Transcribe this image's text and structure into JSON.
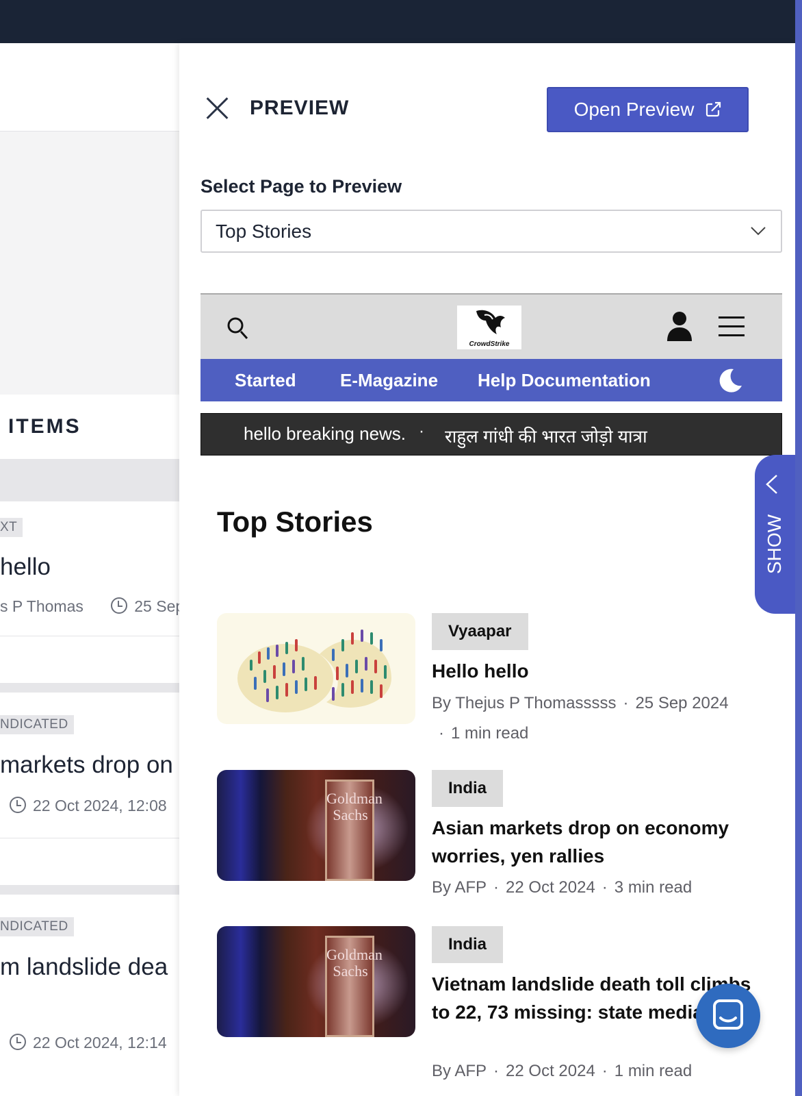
{
  "background_list": {
    "items_heading": "ITEMS",
    "cards": [
      {
        "tag": "XT",
        "title": "hello",
        "author": "s P Thomas",
        "date": "25 Sep"
      },
      {
        "tag": "NDICATED",
        "title": "markets drop on",
        "date": "22 Oct 2024, 12:08"
      },
      {
        "tag": "NDICATED",
        "title": "m landslide dea",
        "date": "22 Oct 2024, 12:14"
      }
    ]
  },
  "drawer": {
    "title": "PREVIEW",
    "open_preview_label": "Open Preview",
    "select_label": "Select Page to Preview",
    "selected_page": "Top Stories"
  },
  "preview": {
    "logo_text": "CrowdStrike",
    "nav": [
      "Started",
      "E-Magazine",
      "Help Documentation"
    ],
    "ticker": [
      "hello breaking news.",
      "राहुल गांधी की भारत जोड़ो यात्रा"
    ],
    "section_title": "Top Stories",
    "stories": [
      {
        "category": "Vyaapar",
        "title": "Hello hello",
        "byline": "By  Thejus P Thomasssss",
        "date": "25 Sep 2024",
        "read": "1 min read"
      },
      {
        "category": "India",
        "title": "Asian markets drop on economy worries, yen rallies",
        "byline": "By  AFP",
        "date": "22 Oct 2024",
        "read": "3 min read"
      },
      {
        "category": "India",
        "title": "Vietnam landslide death toll climbs to 22, 73 missing: state media",
        "byline": "By  AFP",
        "date": "22 Oct 2024",
        "read": "1 min read"
      }
    ],
    "image_sign_text": "Goldman Sachs"
  },
  "side_tab": {
    "label": "SHOW"
  },
  "colors": {
    "accent": "#4a59c4",
    "topbar": "#1a2436",
    "nav": "#4f5fc1",
    "ticker": "#2f2f2f"
  }
}
